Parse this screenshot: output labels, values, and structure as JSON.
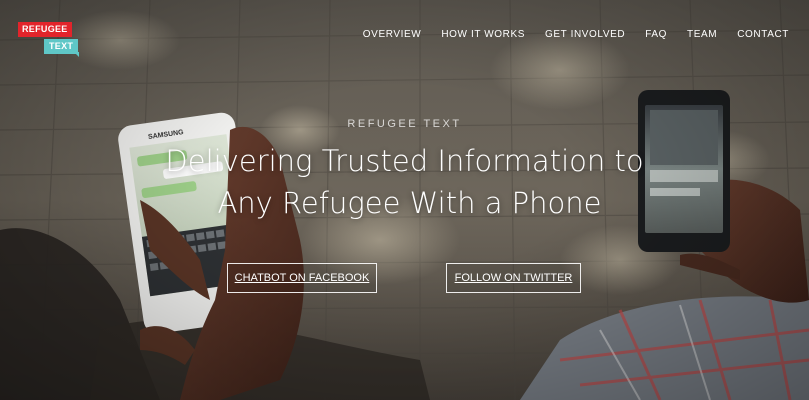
{
  "logo": {
    "line1": "REFUGEE",
    "line2": "TEXT"
  },
  "nav": {
    "items": [
      "OVERVIEW",
      "HOW IT WORKS",
      "GET INVOLVED",
      "FAQ",
      "TEAM",
      "CONTACT"
    ]
  },
  "hero": {
    "eyebrow": "REFUGEE TEXT",
    "headline_line1": "Delivering Trusted Information to",
    "headline_line2": "Any Refugee With a Phone",
    "cta_facebook": "CHATBOT ON FACEBOOK",
    "cta_twitter": "FOLLOW ON TWITTER"
  },
  "phone": {
    "brand": "SAMSUNG"
  },
  "colors": {
    "logo_red": "#e2242b",
    "logo_teal": "#5fc7c7",
    "nav_text": "#ffffff"
  }
}
